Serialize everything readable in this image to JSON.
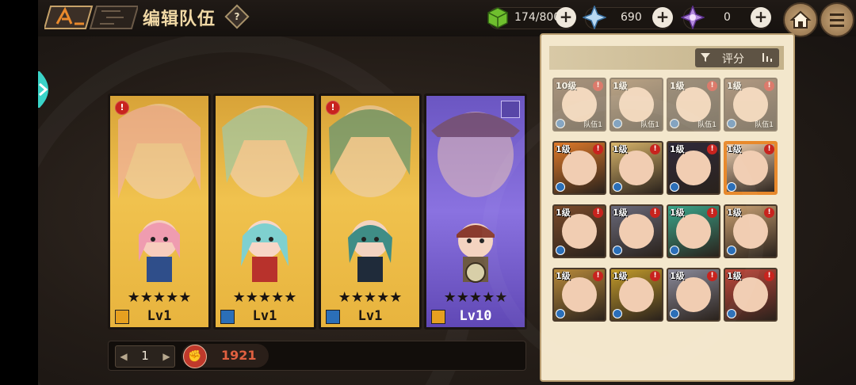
{
  "header": {
    "title": "编辑队伍",
    "help": "?"
  },
  "resources": [
    {
      "name": "stamina",
      "value": "174/800",
      "icon": "green-cube-icon"
    },
    {
      "name": "crystal",
      "value": "690",
      "icon": "crystal-star-icon"
    },
    {
      "name": "premium",
      "value": "0",
      "icon": "purple-gem-icon"
    }
  ],
  "plus_label": "+",
  "team": {
    "cards": [
      {
        "level": "Lv1",
        "stars": "★★★★★",
        "warning": "!",
        "class_color": "#e6a020"
      },
      {
        "level": "Lv1",
        "stars": "★★★★★",
        "warning": "",
        "class_color": "#2b6fb8"
      },
      {
        "level": "Lv1",
        "stars": "★★★★★",
        "warning": "!",
        "class_color": "#2b6fb8"
      },
      {
        "level": "Lv10",
        "stars": "★★★★★",
        "warning": "",
        "class_color": "#e6a020"
      }
    ]
  },
  "bottom": {
    "page": "1",
    "prev": "◀",
    "next": "▶",
    "power": "1921"
  },
  "panel": {
    "sort_label": "评分",
    "roster": [
      {
        "level": "10级",
        "warn": "!",
        "team": "队伍1",
        "state": "dim"
      },
      {
        "level": "1级",
        "warn": "",
        "team": "队伍1",
        "state": "dim"
      },
      {
        "level": "1级",
        "warn": "!",
        "team": "队伍1",
        "state": "dim"
      },
      {
        "level": "1级",
        "warn": "!",
        "team": "队伍1",
        "state": "dim"
      },
      {
        "level": "1级",
        "warn": "!",
        "team": "",
        "state": ""
      },
      {
        "level": "1级",
        "warn": "!",
        "team": "",
        "state": ""
      },
      {
        "level": "1级",
        "warn": "!",
        "team": "",
        "state": ""
      },
      {
        "level": "1级",
        "warn": "!",
        "team": "",
        "state": "sel"
      },
      {
        "level": "1级",
        "warn": "!",
        "team": "",
        "state": ""
      },
      {
        "level": "1级",
        "warn": "!",
        "team": "",
        "state": ""
      },
      {
        "level": "1级",
        "warn": "!",
        "team": "",
        "state": ""
      },
      {
        "level": "1级",
        "warn": "!",
        "team": "",
        "state": ""
      },
      {
        "level": "1级",
        "warn": "!",
        "team": "",
        "state": ""
      },
      {
        "level": "1级",
        "warn": "!",
        "team": "",
        "state": ""
      },
      {
        "level": "1级",
        "warn": "!",
        "team": "",
        "state": ""
      },
      {
        "level": "1级",
        "warn": "!",
        "team": "",
        "state": ""
      }
    ]
  }
}
